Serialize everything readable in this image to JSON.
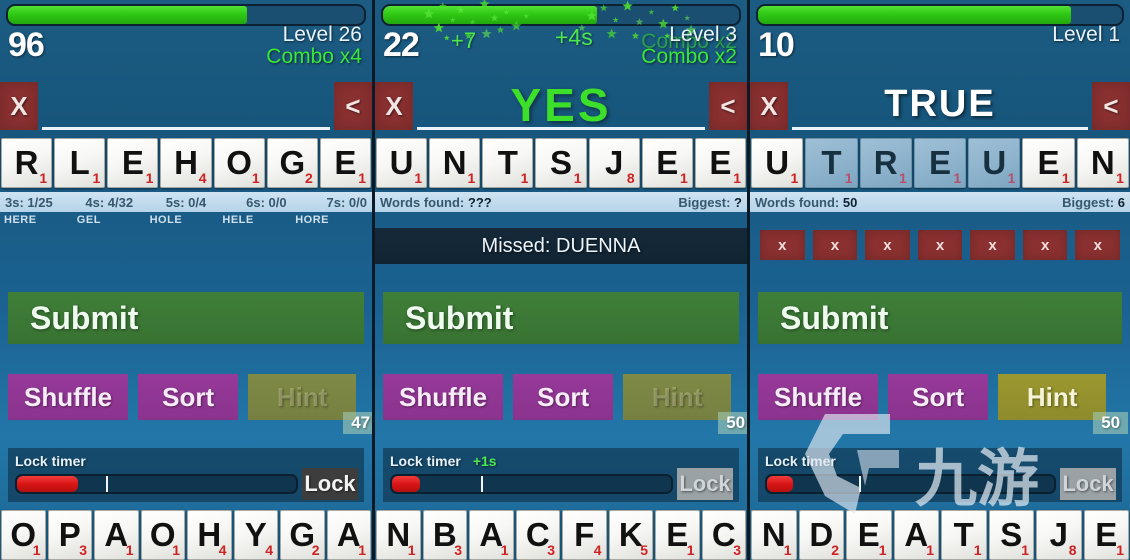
{
  "panels": [
    {
      "id": "panel-1",
      "progress_percent": 67,
      "score": "96",
      "level_label": "Level 26",
      "combo_label": "Combo x4",
      "plus_score": "",
      "plus_time": "",
      "clear_button": "X",
      "back_button": "<",
      "entry_text": "",
      "rack_top": [
        {
          "letter": "R",
          "value": "1",
          "used": false
        },
        {
          "letter": "L",
          "value": "1",
          "used": false
        },
        {
          "letter": "E",
          "value": "1",
          "used": false
        },
        {
          "letter": "H",
          "value": "4",
          "used": false
        },
        {
          "letter": "O",
          "value": "1",
          "used": false
        },
        {
          "letter": "G",
          "value": "2",
          "used": false
        },
        {
          "letter": "E",
          "value": "1",
          "used": false
        }
      ],
      "stats_mode": "lengths",
      "stats": [
        "3s: 1/25",
        "4s: 4/32",
        "5s: 0/4",
        "6s: 0/0",
        "7s: 0/0"
      ],
      "words_found_label": "",
      "words_found_value": "",
      "biggest_label": "",
      "biggest_value": "",
      "found_words": [
        "HERE",
        "GEL",
        "HOLE",
        "HELE",
        "HORE"
      ],
      "missed_text": "",
      "x_chips": [],
      "submit_label": "Submit",
      "shuffle_label": "Shuffle",
      "sort_label": "Sort",
      "hint_label": "Hint",
      "hint_count": "47",
      "hint_disabled": true,
      "lock_timer_label": "Lock timer",
      "lock_bonus": "",
      "lock_fill_percent": 22,
      "lock_mark_percent": 32,
      "lock_button": "Lock",
      "lock_disabled": false,
      "rack_bottom": [
        {
          "letter": "O",
          "value": "1",
          "used": false
        },
        {
          "letter": "P",
          "value": "3",
          "used": false
        },
        {
          "letter": "A",
          "value": "1",
          "used": false
        },
        {
          "letter": "O",
          "value": "1",
          "used": false
        },
        {
          "letter": "H",
          "value": "4",
          "used": false
        },
        {
          "letter": "Y",
          "value": "4",
          "used": false
        },
        {
          "letter": "G",
          "value": "2",
          "used": false
        },
        {
          "letter": "A",
          "value": "1",
          "used": false
        }
      ]
    },
    {
      "id": "panel-2",
      "progress_percent": 60,
      "score": "22",
      "level_label": "Level 3",
      "combo_label": "Combo x2",
      "combo_ghost": "Combo x2",
      "plus_score": "+7",
      "plus_time": "+4s",
      "clear_button": "X",
      "back_button": "<",
      "entry_text": "YES",
      "entry_style": "yes",
      "rack_top": [
        {
          "letter": "U",
          "value": "1",
          "used": false
        },
        {
          "letter": "N",
          "value": "1",
          "used": false
        },
        {
          "letter": "T",
          "value": "1",
          "used": false
        },
        {
          "letter": "S",
          "value": "1",
          "used": false
        },
        {
          "letter": "J",
          "value": "8",
          "used": false
        },
        {
          "letter": "E",
          "value": "1",
          "used": false
        },
        {
          "letter": "E",
          "value": "1",
          "used": false
        }
      ],
      "stats_mode": "words",
      "stats": [],
      "words_found_label": "Words found:",
      "words_found_value": "???",
      "biggest_label": "Biggest:",
      "biggest_value": "?",
      "found_words": [],
      "missed_text": "Missed: DUENNA",
      "x_chips": [],
      "submit_label": "Submit",
      "shuffle_label": "Shuffle",
      "sort_label": "Sort",
      "hint_label": "Hint",
      "hint_count": "50",
      "hint_disabled": true,
      "lock_timer_label": "Lock timer",
      "lock_bonus": "+1s",
      "lock_fill_percent": 10,
      "lock_mark_percent": 32,
      "lock_button": "Lock",
      "lock_disabled": true,
      "rack_bottom": [
        {
          "letter": "N",
          "value": "1",
          "used": false
        },
        {
          "letter": "B",
          "value": "3",
          "used": false
        },
        {
          "letter": "A",
          "value": "1",
          "used": false
        },
        {
          "letter": "C",
          "value": "3",
          "used": false
        },
        {
          "letter": "F",
          "value": "4",
          "used": false
        },
        {
          "letter": "K",
          "value": "5",
          "used": false
        },
        {
          "letter": "E",
          "value": "1",
          "used": false
        },
        {
          "letter": "C",
          "value": "3",
          "used": false
        }
      ]
    },
    {
      "id": "panel-3",
      "progress_percent": 86,
      "score": "10",
      "level_label": "Level 1",
      "combo_label": "",
      "plus_score": "",
      "plus_time": "",
      "clear_button": "X",
      "back_button": "<",
      "entry_text": "TRUE",
      "rack_top": [
        {
          "letter": "U",
          "value": "1",
          "used": false
        },
        {
          "letter": "T",
          "value": "1",
          "used": true
        },
        {
          "letter": "R",
          "value": "1",
          "used": true
        },
        {
          "letter": "E",
          "value": "1",
          "used": true
        },
        {
          "letter": "U",
          "value": "1",
          "used": true
        },
        {
          "letter": "E",
          "value": "1",
          "used": false
        },
        {
          "letter": "N",
          "value": "1",
          "used": false
        }
      ],
      "stats_mode": "words",
      "stats": [],
      "words_found_label": "Words found:",
      "words_found_value": "50",
      "biggest_label": "Biggest:",
      "biggest_value": "6",
      "found_words": [],
      "missed_text": "",
      "x_chips": [
        "x",
        "x",
        "x",
        "x",
        "x",
        "x",
        "x"
      ],
      "submit_label": "Submit",
      "shuffle_label": "Shuffle",
      "sort_label": "Sort",
      "hint_label": "Hint",
      "hint_count": "50",
      "hint_disabled": false,
      "lock_timer_label": "Lock timer",
      "lock_bonus": "",
      "lock_fill_percent": 9,
      "lock_mark_percent": 32,
      "lock_button": "Lock",
      "lock_disabled": true,
      "watermark": true,
      "rack_bottom": [
        {
          "letter": "N",
          "value": "1",
          "used": false
        },
        {
          "letter": "D",
          "value": "2",
          "used": false
        },
        {
          "letter": "E",
          "value": "1",
          "used": false
        },
        {
          "letter": "A",
          "value": "1",
          "used": false
        },
        {
          "letter": "T",
          "value": "1",
          "used": false
        },
        {
          "letter": "S",
          "value": "1",
          "used": false
        },
        {
          "letter": "J",
          "value": "8",
          "used": false
        },
        {
          "letter": "E",
          "value": "1",
          "used": false
        }
      ]
    }
  ],
  "colors": {
    "background_blue": "#1d6593",
    "progress_green": "#2fc914",
    "submit_green": "#3f7f39",
    "action_purple": "#97399a",
    "hint_olive": "#9b9830",
    "danger_red": "#8a3030",
    "lock_red": "#d61414",
    "combo_green": "#3ae63a"
  }
}
